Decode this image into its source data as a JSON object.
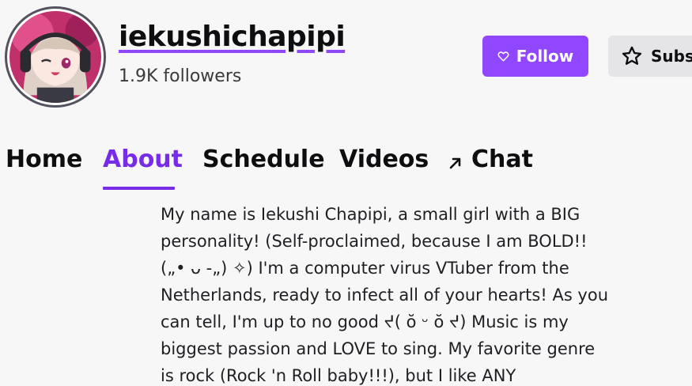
{
  "channel": {
    "name": "iekushichapipi",
    "followers": "1.9K followers",
    "avatar_icon": "anime-girl-avatar-icon"
  },
  "actions": {
    "follow_label": "Follow",
    "follow_icon": "heart-icon",
    "subscribe_label": "Subscribe",
    "subscribe_icon": "star-icon",
    "accent_color": "#9147ff"
  },
  "tabs": [
    {
      "label": "Home",
      "active": false
    },
    {
      "label": "About",
      "active": true
    },
    {
      "label": "Schedule",
      "active": false
    },
    {
      "label": "Videos",
      "active": false
    },
    {
      "label": "Chat",
      "active": false,
      "icon": "popout-arrow-icon"
    }
  ],
  "about": {
    "text": "My name is Iekushi Chapipi, a small girl with a BIG personality! (Self-proclaimed, because I am BOLD!! („• ᴗ -„) ✧) I'm a computer virus VTuber from the Netherlands, ready to infect all of your hearts! As you can tell, I'm up to no good ᔪ( ŏ ᵕ ŏ ᔪ) Music is my biggest passion and LOVE to sing. My favorite genre is rock (Rock 'n Roll baby!!!), but I like ANY"
  }
}
